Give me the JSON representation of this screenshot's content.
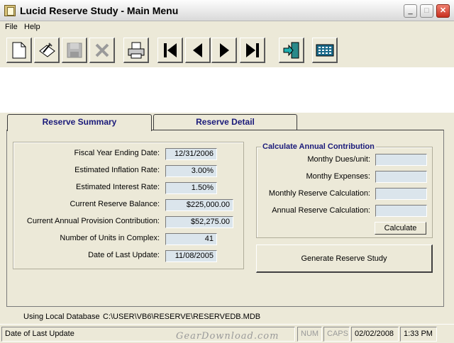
{
  "window": {
    "title": "Lucid Reserve Study - Main Menu",
    "minimize_glyph": "_",
    "maximize_glyph": "□",
    "close_glyph": "✕"
  },
  "menu": [
    "File",
    "Help"
  ],
  "toolbar": {
    "buttons": [
      "new-icon",
      "edit-icon",
      "save-icon",
      "delete-icon",
      "print-icon",
      "first-record-icon",
      "previous-record-icon",
      "next-record-icon",
      "last-record-icon",
      "exit-icon",
      "calculator-icon"
    ]
  },
  "tabs": {
    "summary": "Reserve Summary",
    "detail": "Reserve Detail"
  },
  "summary": {
    "rows": [
      {
        "label": "Fiscal Year Ending Date:",
        "value": "12/31/2006"
      },
      {
        "label": "Estimated Inflation Rate:",
        "value": "3.00%"
      },
      {
        "label": "Estimated Interest Rate:",
        "value": "1.50%"
      },
      {
        "label": "Current Reserve Balance:",
        "value": "$225,000.00"
      },
      {
        "label": "Current Annual Provision Contribution:",
        "value": "$52,275.00"
      },
      {
        "label": "Number of Units in Complex:",
        "value": "41"
      },
      {
        "label": "Date of Last Update:",
        "value": "11/08/2005"
      }
    ]
  },
  "calc": {
    "title": "Calculate Annual Contribution",
    "rows": [
      {
        "label": "Monthy Dues/unit:",
        "value": ""
      },
      {
        "label": "Monthy Expenses:",
        "value": ""
      },
      {
        "label": "Monthly Reserve Calculation:",
        "value": ""
      },
      {
        "label": "Annual Reserve Calculation:",
        "value": ""
      }
    ],
    "button": "Calculate"
  },
  "generate_button": "Generate Reserve Study",
  "database": {
    "label": "Using Local Database",
    "path": "C:\\USER\\VB6\\RESERVE\\RESERVEDB.MDB"
  },
  "status": {
    "message": "Date of Last Update",
    "num": "NUM",
    "caps": "CAPS",
    "date": "02/02/2008",
    "time": "1:33 PM"
  },
  "watermark": "GearDownload.com",
  "colors": {
    "field_bg": "#dbe5ec",
    "tab_text": "#1a1a7a",
    "window_bg": "#ece9d8"
  }
}
